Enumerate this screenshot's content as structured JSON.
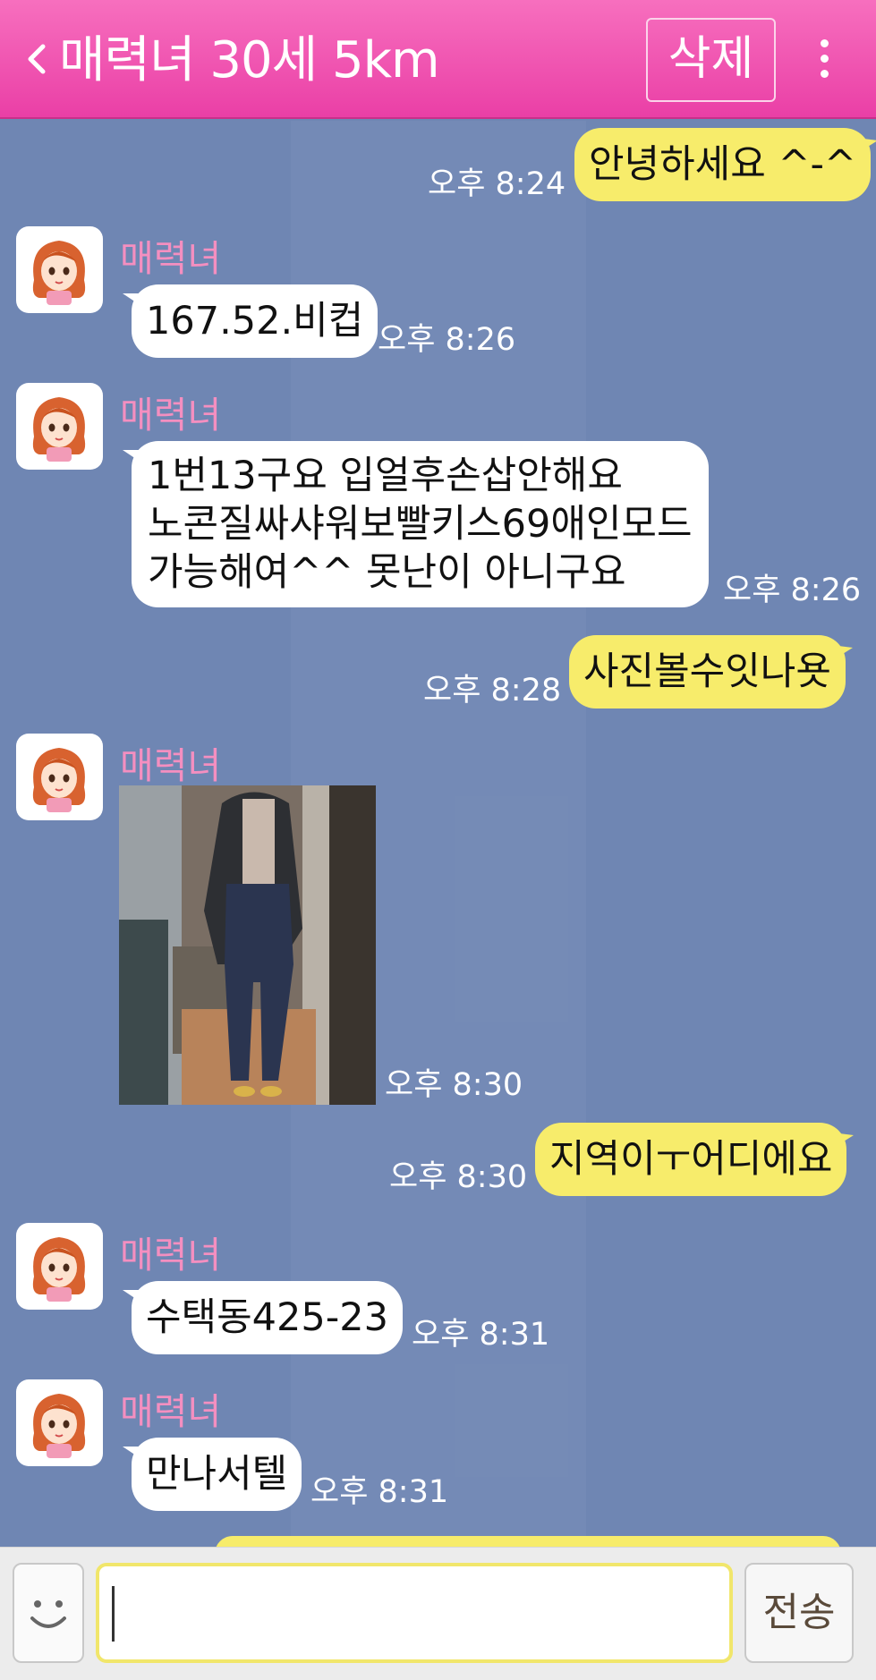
{
  "header": {
    "title": "매력녀 30세 5km",
    "delete_label": "삭제"
  },
  "messages": [
    {
      "from": "me",
      "text": "안녕하세요 ^-^",
      "time": "오후 8:24"
    },
    {
      "from": "them",
      "sender": "매력녀",
      "text": "167.52.비컵",
      "time": "오후 8:26"
    },
    {
      "from": "them",
      "sender": "매력녀",
      "lines": [
        "1번13구요 입얼후손삽안해요",
        "노콘질싸샤워보빨키스69애인모드",
        "가능해여^^ 못난이 아니구요"
      ],
      "time": "오후 8:26"
    },
    {
      "from": "me",
      "text": "사진볼수잇나욧",
      "time": "오후 8:28"
    },
    {
      "from": "them",
      "sender": "매력녀",
      "image": true,
      "time": "오후 8:30"
    },
    {
      "from": "me",
      "text": "지역이ㅜ어디에요",
      "time": "오후 8:30"
    },
    {
      "from": "them",
      "sender": "매력녀",
      "text": "수택동425-23",
      "time": "오후 8:31"
    },
    {
      "from": "them",
      "sender": "매력녀",
      "text": "만나서텔",
      "time": "오후 8:31"
    }
  ],
  "input": {
    "value": "",
    "send_label": "전송"
  },
  "colors": {
    "header": "#ea3fa6",
    "chat_background": "#6f86b3",
    "my_bubble": "#f7ec6b",
    "their_bubble": "#ffffff",
    "sender_name": "#f48fc0"
  }
}
